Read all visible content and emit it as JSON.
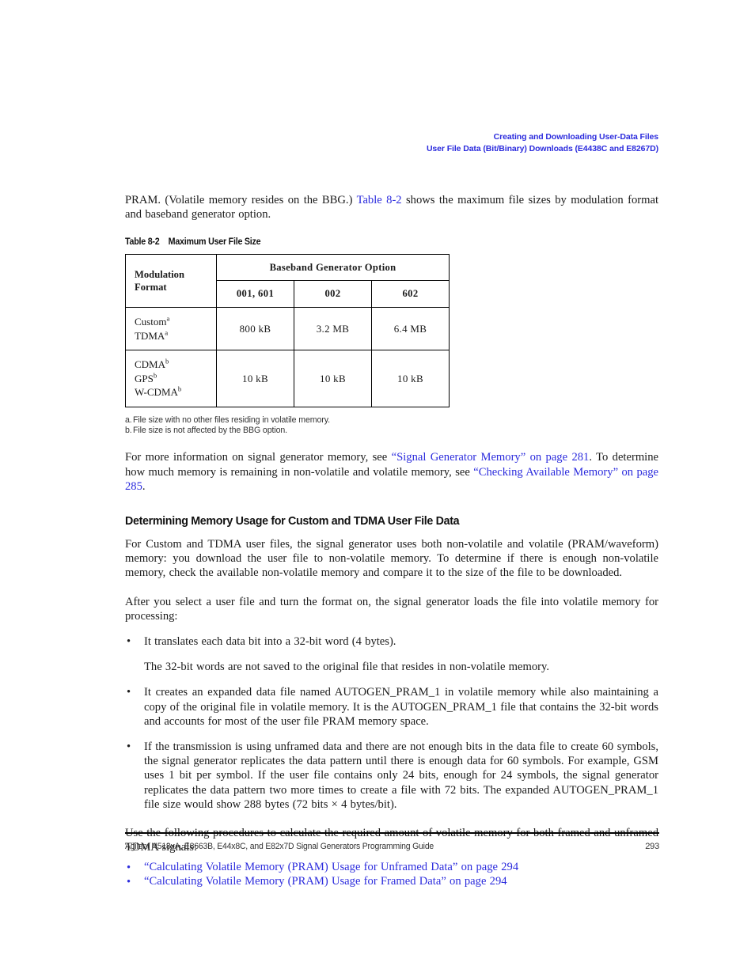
{
  "header": {
    "line1": "Creating and Downloading User-Data Files",
    "line2": "User File Data (Bit/Binary) Downloads (E4438C and E8267D)",
    "link_color": "#2b2bdd"
  },
  "intro": {
    "text_before_xref": "PRAM. (Volatile memory resides on the BBG.) ",
    "xref": "Table 8-2",
    "text_after_xref": " shows the maximum file sizes by modulation format and baseband generator option."
  },
  "table": {
    "caption_number": "Table 8-2",
    "caption_title": "Maximum User File Size",
    "row_header_label": "Modulation Format",
    "group_header": "Baseband Generator Option",
    "column_headers": [
      "001, 601",
      "002",
      "602"
    ],
    "rows": [
      {
        "labels": [
          {
            "text": "Custom",
            "sup": "a"
          },
          {
            "text": "TDMA",
            "sup": "a"
          }
        ],
        "values": [
          "800 kB",
          "3.2 MB",
          "6.4 MB"
        ]
      },
      {
        "labels": [
          {
            "text": "CDMA",
            "sup": "b"
          },
          {
            "text": "GPS",
            "sup": "b"
          },
          {
            "text": "W-CDMA",
            "sup": "b"
          }
        ],
        "values": [
          "10 kB",
          "10 kB",
          "10 kB"
        ]
      }
    ],
    "footnotes": [
      {
        "mark": "a.",
        "text": "File size with no other files residing in volatile memory."
      },
      {
        "mark": "b.",
        "text": "File size is not affected by the BBG option."
      }
    ]
  },
  "memory_info_paragraph": {
    "seg1": "For more information on signal generator memory, see ",
    "xref1": "“Signal Generator Memory” on page 281",
    "seg2": ". To determine how much memory is remaining in non-volatile and volatile memory, see ",
    "xref2": "“Checking Available Memory” on page 285",
    "seg3": "."
  },
  "section": {
    "heading": "Determining Memory Usage for Custom and TDMA User File Data",
    "paragraph1": "For Custom and TDMA user files, the signal generator uses both non-volatile and volatile (PRAM/waveform) memory: you download the user file to non-volatile memory. To determine if there is enough non-volatile memory, check the available non-volatile memory and compare it to the size of the file to be downloaded.",
    "paragraph2": "After you select a user file and turn the format on, the signal generator loads the file into volatile memory for processing:",
    "bullets": [
      {
        "text": "It translates each data bit into a 32-bit word (4 bytes).",
        "sub_text": "The 32-bit words are not saved to the original file that resides in non-volatile memory."
      },
      {
        "text": "It creates an expanded data file named AUTOGEN_PRAM_1 in volatile memory while also maintaining a copy of the original file in volatile memory. It is the AUTOGEN_PRAM_1 file that contains the 32-bit words and accounts for most of the user file PRAM memory space."
      },
      {
        "text": "If the transmission is using unframed data and there are not enough bits in the data file to create 60 symbols, the signal generator replicates the data pattern until there is enough data for 60 symbols. For example, GSM uses 1 bit per symbol. If the user file contains only 24 bits, enough for 24 symbols, the signal generator replicates the data pattern two more times to create a file with 72 bits. The expanded AUTOGEN_PRAM_1 file size would show 288 bytes (72 bits × 4 bytes/bit)."
      }
    ],
    "paragraph3": "Use the following procedures to calculate the required amount of volatile memory for both framed and unframed TDMA signals:",
    "xref_bullets": [
      "“Calculating Volatile Memory (PRAM) Usage for Unframed Data” on page 294",
      "“Calculating Volatile Memory (PRAM) Usage for Framed Data” on page 294"
    ]
  },
  "footer": {
    "left": "Agilent N518xA, E8663B, E44x8C, and E82x7D Signal Generators Programming Guide",
    "page_number": "293"
  }
}
